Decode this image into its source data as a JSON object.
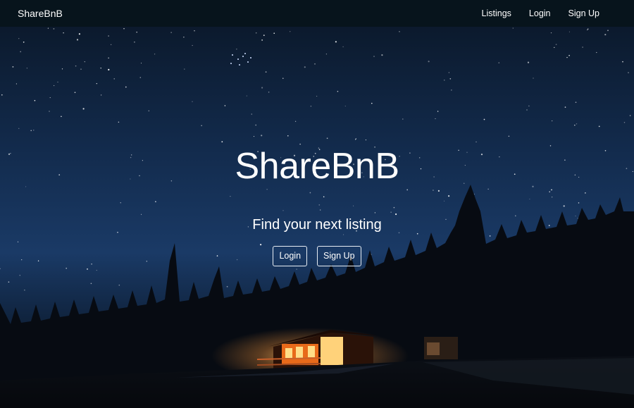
{
  "navbar": {
    "brand": "ShareBnB",
    "links": [
      "Listings",
      "Login",
      "Sign Up"
    ]
  },
  "hero": {
    "title": "ShareBnB",
    "subtitle": "Find your next listing",
    "buttons": [
      "Login",
      "Sign Up"
    ]
  },
  "colors": {
    "navbar_bg": "#07141c",
    "sky_top": "#0d1b2e",
    "sky_mid": "#16305a",
    "text": "#ffffff",
    "cabin_light": "#ffb347"
  }
}
